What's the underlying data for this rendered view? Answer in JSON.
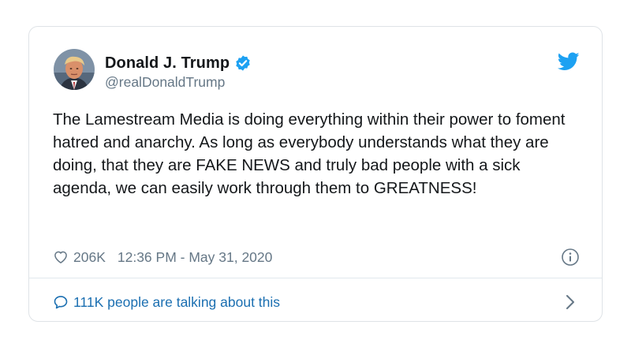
{
  "author": {
    "name": "Donald J. Trump",
    "handle": "@realDonaldTrump",
    "verified": true
  },
  "tweet": {
    "text": "The Lamestream Media is doing everything within their power to foment hatred and anarchy. As long as everybody understands what they are doing, that they are FAKE NEWS and truly bad people with a sick agenda, we can easily work through them to GREATNESS!"
  },
  "meta": {
    "likes": "206K",
    "timestamp": "12:36 PM - May 31, 2020"
  },
  "footer": {
    "conversation_label": "111K people are talking about this"
  },
  "icons": {
    "verified": "verified-badge-icon",
    "brand": "twitter-bird-icon",
    "like": "heart-icon",
    "info": "info-icon",
    "conversation": "speech-bubble-icon",
    "chevron": "chevron-right-icon"
  },
  "colors": {
    "brand_blue": "#1da1f2",
    "link_blue": "#1b6fb1",
    "text": "#14171a",
    "muted": "#657786"
  }
}
